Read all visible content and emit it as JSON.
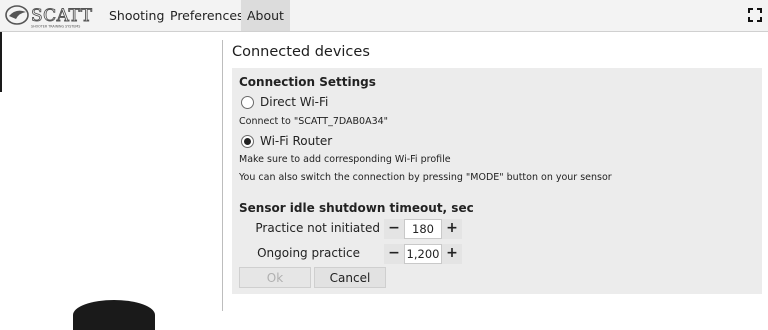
{
  "menubar": {
    "logo_text": "SCATT",
    "logo_subtitle": "SHOOTER TRAINING SYSTEMS",
    "items": [
      {
        "label": "Shooting"
      },
      {
        "label": "Preferences"
      },
      {
        "label": "About"
      }
    ],
    "active_item": "About",
    "fullscreen_icon": "fullscreen-icon"
  },
  "page": {
    "title": "Connected devices"
  },
  "connection": {
    "title": "Connection Settings",
    "options": [
      {
        "label": "Direct Wi-Fi",
        "checked": false,
        "hint": "Connect to \"SCATT_7DAB0A34\""
      },
      {
        "label": "Wi-Fi Router",
        "checked": true,
        "hint": "Make sure to add corresponding Wi-Fi profile"
      }
    ],
    "footer_hint": "You can also switch the connection by pressing \"MODE\" button on your sensor"
  },
  "idle_shutdown": {
    "title": "Sensor idle shutdown timeout, sec",
    "rows": [
      {
        "label": "Practice not initiated",
        "value": "180",
        "minus": "−",
        "plus": "+"
      },
      {
        "label": "Ongoing practice",
        "value": "1,200",
        "minus": "−",
        "plus": "+"
      }
    ]
  },
  "actions": {
    "ok_label": "Ok",
    "ok_enabled": false,
    "cancel_label": "Cancel"
  },
  "colors": {
    "menubar_bg": "#f3f3f3",
    "active_menu_bg": "#dcdcdc",
    "panel_bg": "#ececec"
  }
}
